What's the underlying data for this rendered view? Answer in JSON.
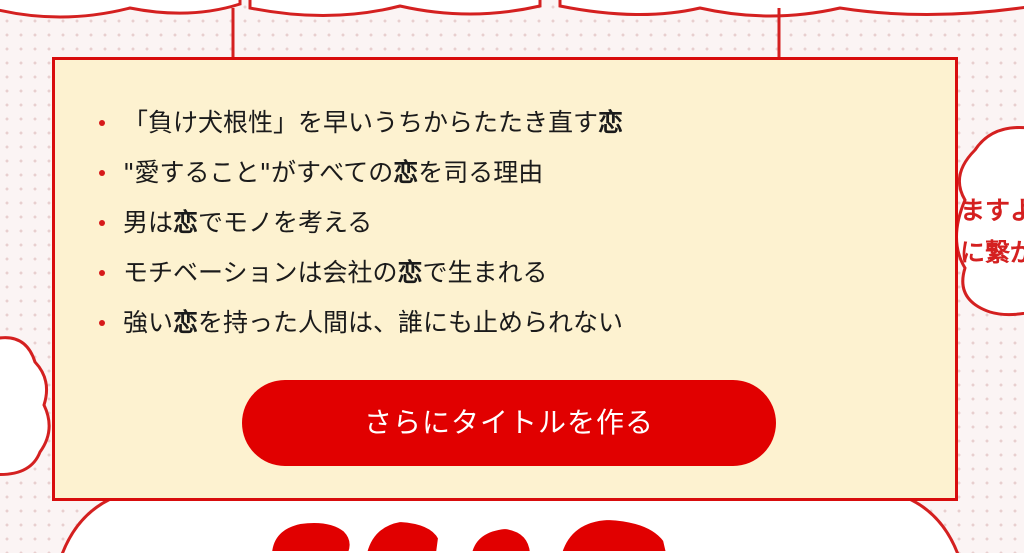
{
  "title_list": {
    "items": [
      {
        "before": "「負け犬根性」を早いうちからたたき直す",
        "keyword": "恋",
        "after": ""
      },
      {
        "before": "\"愛すること\"がすべての",
        "keyword": "恋",
        "after": "を司る理由"
      },
      {
        "before": "男は",
        "keyword": "恋",
        "after": "でモノを考える"
      },
      {
        "before": "モチベーションは会社の",
        "keyword": "恋",
        "after": "で生まれる"
      },
      {
        "before": "強い",
        "keyword": "恋",
        "after": "を持った人間は、誰にも止められない"
      }
    ]
  },
  "buttons": {
    "more_titles_label": "さらにタイトルを作る"
  },
  "right_bubble": {
    "line1": "ますよ",
    "line2": "に繋が"
  },
  "colors": {
    "accent_red": "#e10000",
    "panel_bg": "#fdf2d0",
    "panel_border": "#d80d0d",
    "page_bg": "#fbf4f4"
  }
}
